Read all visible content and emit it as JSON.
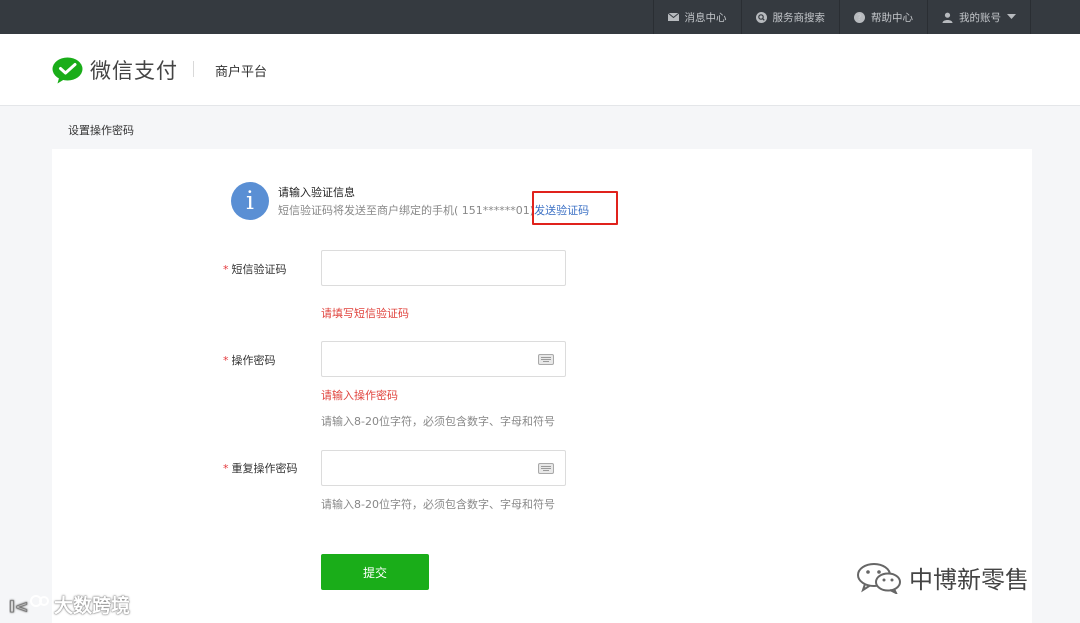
{
  "topbar": {
    "items": [
      {
        "icon": "mail-icon",
        "label": "消息中心"
      },
      {
        "icon": "search-icon",
        "label": "服务商搜索"
      },
      {
        "icon": "help-icon",
        "label": "帮助中心"
      },
      {
        "icon": "user-icon",
        "label": "我的账号"
      }
    ]
  },
  "header": {
    "logo_text": "微信支付",
    "platform": "商户平台"
  },
  "page": {
    "title": "设置操作密码"
  },
  "notice": {
    "title": "请输入验证信息",
    "desc": "短信验证码将发送至商户绑定的手机( 151******01)",
    "send_link": "发送验证码"
  },
  "form": {
    "sms": {
      "label": "短信验证码",
      "value": "",
      "error": "请填写短信验证码"
    },
    "password": {
      "label": "操作密码",
      "value": "",
      "error": "请输入操作密码",
      "hint": "请输入8-20位字符，必须包含数字、字母和符号"
    },
    "repeat": {
      "label": "重复操作密码",
      "value": "",
      "hint": "请输入8-20位字符，必须包含数字、字母和符号"
    },
    "required_mark": "*",
    "submit_label": "提交"
  },
  "watermarks": {
    "left": "大数跨境",
    "right": "中博新零售"
  },
  "colors": {
    "topbar": "#353a40",
    "brand_green": "#1aad19",
    "info_blue": "#5a8fd4",
    "link": "#3a6fc4",
    "error": "#e0443e",
    "highlight": "#e0221c"
  }
}
